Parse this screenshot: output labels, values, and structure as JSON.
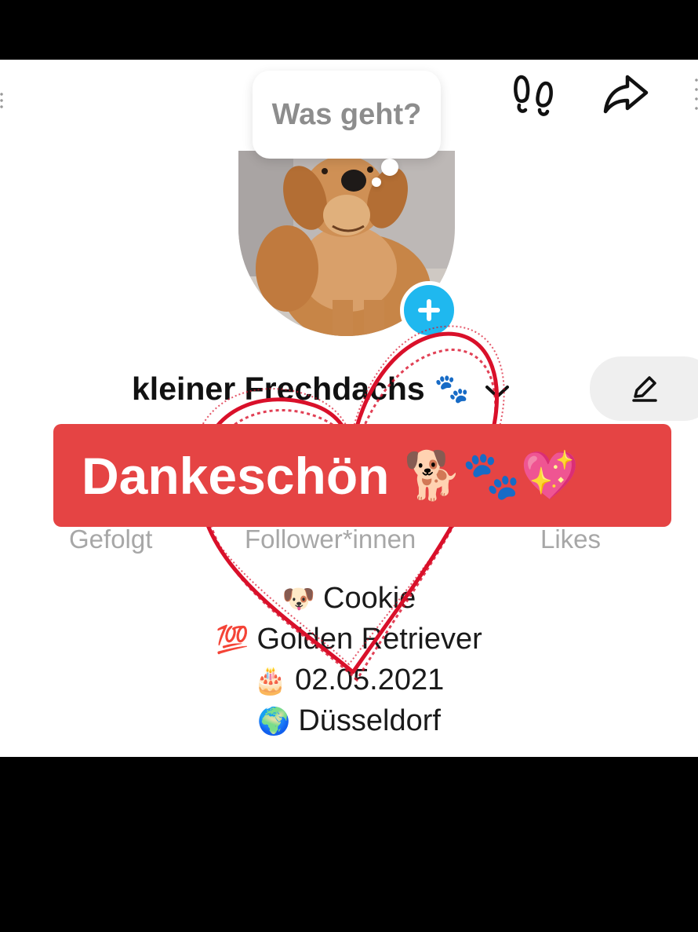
{
  "speech_bubble": {
    "text": "Was geht?"
  },
  "header": {
    "footprints_icon": "footprints-icon",
    "share_icon": "share-arrow-icon"
  },
  "profile": {
    "username": "kleiner Frechdachs",
    "username_emoji": "🐾",
    "chevron_icon": "chevron-down-icon",
    "edit_icon": "pencil-icon",
    "add_icon": "plus-icon"
  },
  "banner": {
    "text": "Dankeschön",
    "emoji": "🐕🐾💖"
  },
  "stats": {
    "following_label": "Gefolgt",
    "followers_label": "Follower*innen",
    "likes_label": "Likes"
  },
  "bio": [
    {
      "emoji": "🐶",
      "text": "Cookie"
    },
    {
      "emoji": "💯",
      "text": "Golden Retriever"
    },
    {
      "emoji": "🎂",
      "text": "02.05.2021"
    },
    {
      "emoji": "🌍",
      "text": "Düsseldorf"
    }
  ],
  "colors": {
    "banner": "#e54444",
    "add_button": "#1fb8ef",
    "heart_drawing": "#d9102a"
  }
}
